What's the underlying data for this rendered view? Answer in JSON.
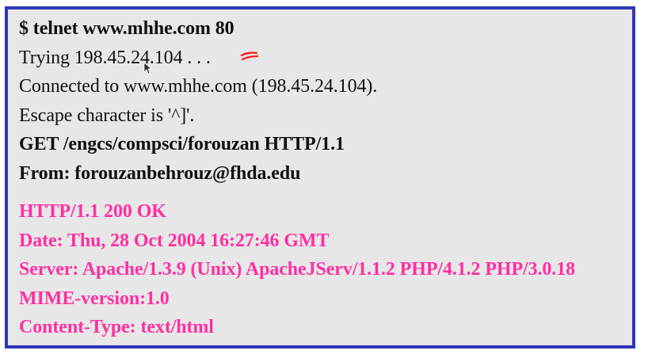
{
  "colors": {
    "frame_border": "#2f35b9",
    "panel_background": "#e7e7e7",
    "command_text": "#111111",
    "response_text": "#ff2fa1",
    "annotation_stroke": "#ff1d1d"
  },
  "session": {
    "command_lines": [
      "$ telnet www.mhhe.com 80",
      "Trying 198.45.24.104 . . .",
      "Connected to www.mhhe.com (198.45.24.104).",
      "Escape character is '^]'.",
      "GET /engcs/compsci/forouzan HTTP/1.1",
      "From: forouzanbehrouz@fhda.edu"
    ],
    "response_lines": [
      "HTTP/1.1 200 OK",
      "Date: Thu, 28 Oct 2004 16:27:46 GMT",
      "Server: Apache/1.3.9 (Unix) ApacheJServ/1.1.2 PHP/4.1.2 PHP/3.0.18",
      "MIME-version:1.0",
      "Content-Type: text/html"
    ]
  },
  "icons": {
    "annotation": "handwritten-annotation-icon",
    "cursor": "mouse-cursor-icon"
  }
}
